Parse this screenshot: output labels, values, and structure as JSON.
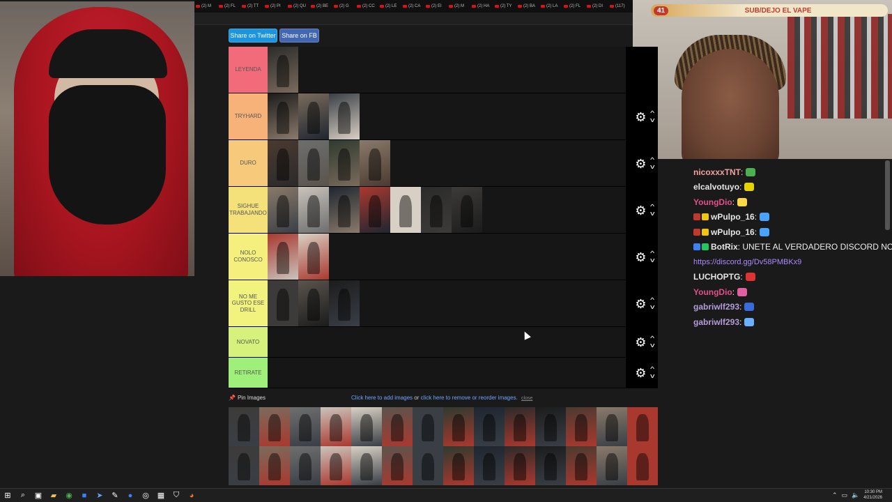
{
  "tabs": [
    "(2) M",
    "(2) FL",
    "(2) TT",
    "(2) PI",
    "(2) QU",
    "(2) BE",
    "(2) G",
    "(2) CC",
    "(2) LE",
    "(2) CA",
    "(2) EI",
    "(2) M",
    "(2) HA",
    "(2) TY",
    "(2) BA",
    "(2) LA",
    "(2) FL",
    "(2) DI",
    "(117)"
  ],
  "share": {
    "twitter": "Share on Twitter",
    "facebook": "Share on FB"
  },
  "tiers": [
    {
      "label": "LEYENDA",
      "color": "#f26b7a",
      "items": 1
    },
    {
      "label": "TRYHARD",
      "color": "#f7b27a",
      "items": 3
    },
    {
      "label": "DURO",
      "color": "#f7c97a",
      "items": 4
    },
    {
      "label": "SIGHUE TRABAJANDO",
      "color": "#f5e17a",
      "items": 7
    },
    {
      "label": "NOLO CONOSCO",
      "color": "#f5f07e",
      "items": 2
    },
    {
      "label": "NO ME GUSTO ESE DRILL",
      "color": "#f2f27e",
      "items": 3
    },
    {
      "label": "NOVATO",
      "color": "#d6f27c",
      "items": 0
    },
    {
      "label": "RETIRATE",
      "color": "#9ef07a",
      "items": 0
    }
  ],
  "pin": {
    "label": "Pin Images",
    "add_link": "Click here to add images",
    "or": "or",
    "remove_link": "click here to remove or reorder images.",
    "close": "close"
  },
  "overlay": {
    "count": "41",
    "text": "SUB/DEJO EL VAPE"
  },
  "chat": [
    {
      "user": "nicoxxxTNT",
      "color": "#f2a0a0",
      "sep": " :",
      "emote": "#4caf50"
    },
    {
      "user": "elcalvotuyo",
      "color": "#e6e6e6",
      "sep": " :",
      "emote": "#e6d200"
    },
    {
      "user": "YoungDio",
      "color": "#e0508a",
      "sep": " :",
      "emote": "#ffd84a"
    },
    {
      "user": "wPulpo_16",
      "color": "#e6e6e6",
      "sep": " :",
      "emote": "#4aa3ff",
      "badges": [
        "#c0392b",
        "#f1c40f"
      ]
    },
    {
      "user": "wPulpo_16",
      "color": "#e6e6e6",
      "sep": " :",
      "emote": "#4aa3ff",
      "badges": [
        "#c0392b",
        "#f1c40f"
      ]
    },
    {
      "user": "BotRix",
      "color": "#e6e6e6",
      "sep": " : UNETE AL VERDADERO DISCORD NO VU",
      "badges": [
        "#3b82f6",
        "#22c55e"
      ]
    },
    {
      "link": "https://discord.gg/Dv58PMBKx9"
    },
    {
      "user": "LUCHOPTG",
      "color": "#e6e6e6",
      "sep": " :",
      "emote": "#d33"
    },
    {
      "user": "YoungDio",
      "color": "#e0508a",
      "sep": " :",
      "emote": "#e060a0"
    },
    {
      "user": "gabriwlf293",
      "color": "#b39ddb",
      "sep": " :",
      "emote": "#3a6bd8"
    },
    {
      "user": "gabriwlf293",
      "color": "#b39ddb",
      "sep": " :",
      "emote": "#6ab0ff"
    }
  ],
  "clock": {
    "time": "10:30 PM",
    "date": "4/21/2026"
  }
}
